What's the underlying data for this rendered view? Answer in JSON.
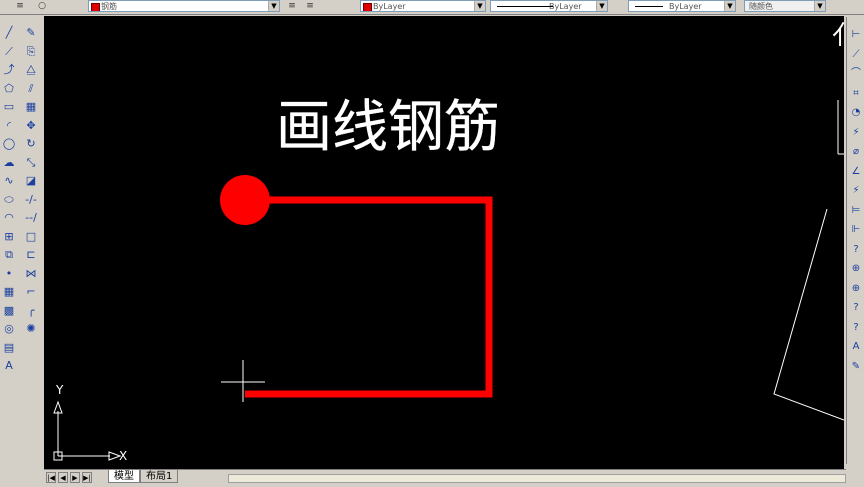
{
  "properties_bar": {
    "layer_name": "钢筋",
    "color_value": "ByLayer",
    "linetype_value": "ByLayer",
    "lineweight_value": "ByLayer",
    "plotstyle_value": "随颜色",
    "layer_color": "#e00000"
  },
  "canvas": {
    "annotation_text": "画线钢筋",
    "rebar_color": "#ff0000",
    "text_color": "#ffffff",
    "background": "#000000"
  },
  "ucs": {
    "x_label": "X",
    "y_label": "Y"
  },
  "tabs": {
    "model": "模型",
    "layout1": "布局1"
  },
  "draw_toolbar": [
    "line-icon",
    "construction-line-icon",
    "polyline-icon",
    "polygon-icon",
    "rectangle-icon",
    "arc-icon",
    "circle-icon",
    "revision-cloud-icon",
    "spline-icon",
    "ellipse-icon",
    "ellipse-arc-icon",
    "insert-block-icon",
    "make-block-icon",
    "point-icon",
    "hatch-icon",
    "gradient-icon",
    "region-icon",
    "table-icon",
    "multiline-text-icon"
  ],
  "modify_toolbar": [
    "erase-icon",
    "copy-icon",
    "mirror-icon",
    "offset-icon",
    "array-icon",
    "move-icon",
    "rotate-icon",
    "scale-icon",
    "stretch-icon",
    "trim-icon",
    "extend-icon",
    "break-at-point-icon",
    "break-icon",
    "join-icon",
    "chamfer-icon",
    "fillet-icon",
    "explode-icon"
  ],
  "dimension_toolbar": [
    "linear-dimension-icon",
    "aligned-dimension-icon",
    "arc-length-icon",
    "ordinate-icon",
    "radius-icon",
    "jogged-icon",
    "diameter-icon",
    "angular-icon",
    "quick-dimension-icon",
    "baseline-icon",
    "continue-icon",
    "quick-leader-icon",
    "tolerance-icon",
    "center-mark-icon",
    "dimension-edit-icon",
    "dimension-text-edit-icon",
    "dimension-update-icon",
    "dimension-style-icon"
  ]
}
